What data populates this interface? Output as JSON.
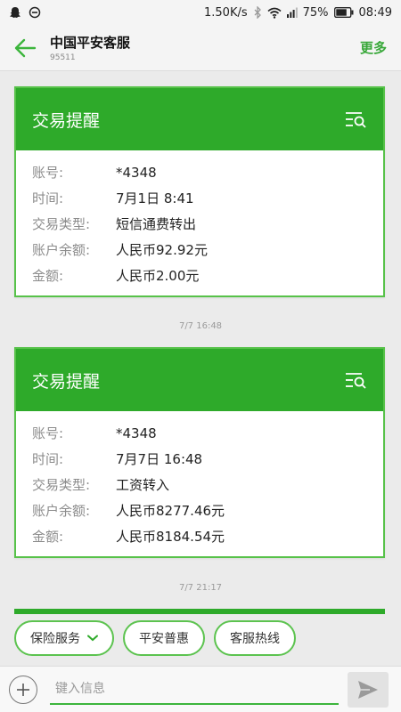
{
  "status_bar": {
    "speed": "1.50K/s",
    "battery": "75%",
    "time": "08:49"
  },
  "header": {
    "title": "中国平安客服",
    "subtitle": "95511",
    "more_label": "更多"
  },
  "messages": [
    {
      "title": "交易提醒",
      "rows": [
        {
          "label": "账号:",
          "value": "*4348"
        },
        {
          "label": "时间:",
          "value": "7月1日 8:41"
        },
        {
          "label": "交易类型:",
          "value": "短信通费转出"
        },
        {
          "label": "账户余额:",
          "value": "人民币92.92元"
        },
        {
          "label": "金额:",
          "value": "人民币2.00元"
        }
      ]
    },
    {
      "title": "交易提醒",
      "rows": [
        {
          "label": "账号:",
          "value": "*4348"
        },
        {
          "label": "时间:",
          "value": "7月7日 16:48"
        },
        {
          "label": "交易类型:",
          "value": "工资转入"
        },
        {
          "label": "账户余额:",
          "value": "人民币8277.46元"
        },
        {
          "label": "金额:",
          "value": "人民币8184.54元"
        }
      ]
    }
  ],
  "timestamps": [
    "7/7 16:48",
    "7/7 21:17"
  ],
  "quick_replies": [
    "保险服务",
    "平安普惠",
    "客服热线"
  ],
  "input": {
    "placeholder": "键入信息"
  },
  "colors": {
    "accent": "#2eaa2a",
    "accent_light": "#5cc34f"
  }
}
